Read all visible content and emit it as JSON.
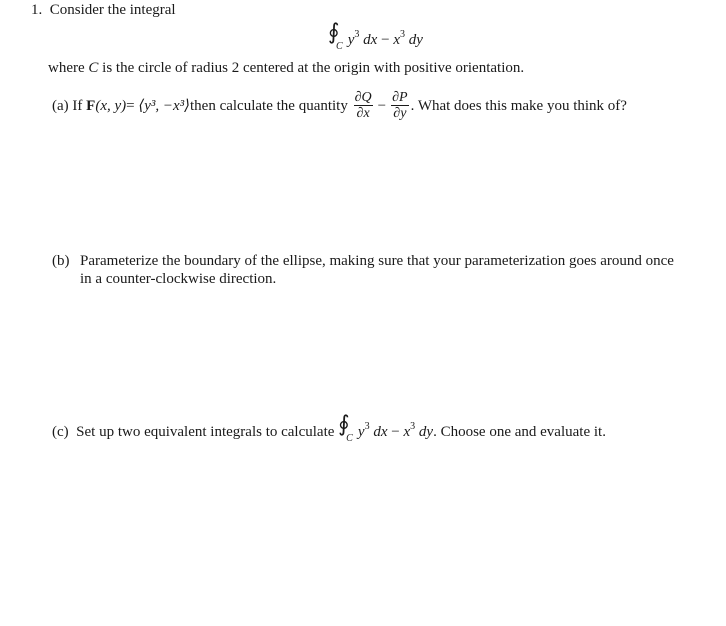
{
  "problem": {
    "number": "1.",
    "intro": "Consider the integral",
    "integral": {
      "symbol": "∮",
      "subscript": "C",
      "term1_var": "y",
      "term1_exp": "3",
      "term1_diff": "dx",
      "op": "−",
      "term2_var": "x",
      "term2_exp": "3",
      "term2_diff": "dy"
    },
    "where_pre": "where ",
    "where_var": "C",
    "where_post": " is the circle of radius 2 centered at the origin with positive orientation."
  },
  "parts": {
    "a": {
      "label": "(a)",
      "pre": "If ",
      "F": "F",
      "args": "(x, y)",
      "eq": " = ",
      "vec": "⟨y³, −x³⟩",
      "mid": " then calculate the quantity ",
      "frac1_num": "∂Q",
      "frac1_den": "∂x",
      "minus": "−",
      "frac2_num": "∂P",
      "frac2_den": "∂y",
      "post": ". What does this make you think of?"
    },
    "b": {
      "label": "(b)",
      "line1": "Parameterize the boundary of the ellipse, making sure that your parameterization goes around once",
      "line2": "in a counter-clockwise direction."
    },
    "c": {
      "label": "(c)",
      "pre": "Set up two equivalent integrals to calculate ",
      "post": ". Choose one and evaluate it."
    }
  }
}
